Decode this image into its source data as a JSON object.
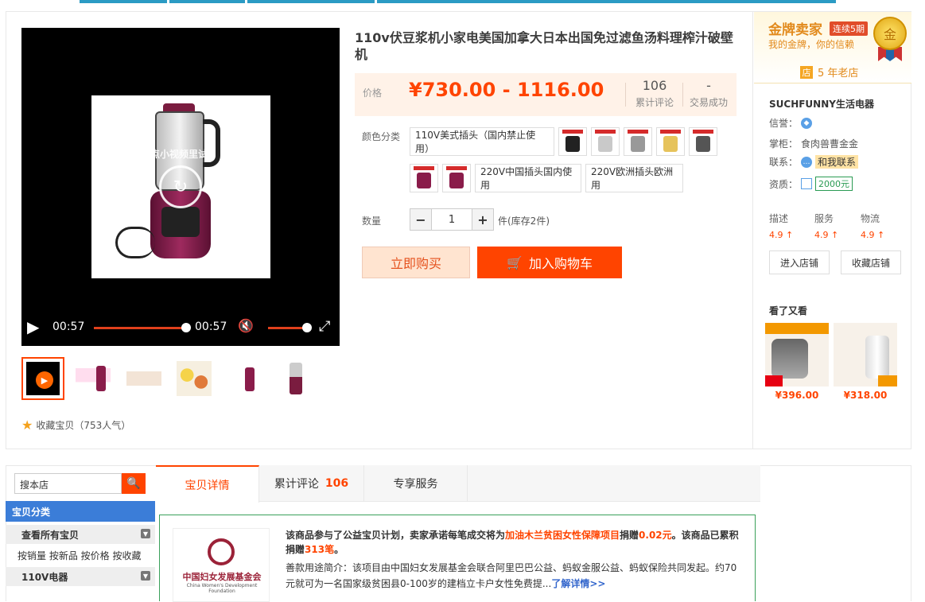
{
  "product": {
    "title": "110v伏豆浆机小家电美国加拿大日本出国免过滤鱼汤料理榨汁破壁机",
    "price_label": "价格",
    "price": "¥730.00 - 1116.00",
    "reviews_count": "106",
    "reviews_label": "累计评论",
    "sales_count": "-",
    "sales_label": "交易成功",
    "color_label": "颜色分类",
    "sku_options": [
      "110V美式插头（国内禁止使用）",
      "220V中国插头国内使用",
      "220V欧洲插头欧洲用"
    ],
    "qty_label": "数量",
    "qty_minus": "−",
    "qty_value": "1",
    "qty_plus": "+",
    "stock": "件(库存2件)",
    "buy_now": "立即购买",
    "add_cart": "加入购物车",
    "cart_icon": "🛒",
    "favorite": "收藏宝贝（753人气）",
    "star_icon": "★"
  },
  "video": {
    "overlay": "有点小视频里试",
    "current_time": "00:57",
    "total_time": "00:57",
    "progress": 1.0,
    "volume": 1.0,
    "play_icon": "▶",
    "mute_icon": "🔇",
    "fullscreen_icon": "⤢",
    "replay_icon": "↻"
  },
  "shop": {
    "gold_title": "金牌卖家",
    "gold_badge": "连续5期",
    "gold_sub": "我的金牌，你的信赖",
    "medal": "金",
    "years_icon": "店",
    "years": "5 年老店",
    "name": "SUCHFUNNY生活电器",
    "credit_label": "信誉：",
    "keeper_label": "掌柜：",
    "keeper": "食肉兽曹金金",
    "contact_label": "联系：",
    "contact": "和我联系",
    "qual_label": "资质：",
    "deposit": "2000元",
    "scores": [
      {
        "label": "描述",
        "value": "4.9 ↑"
      },
      {
        "label": "服务",
        "value": "4.9 ↑"
      },
      {
        "label": "物流",
        "value": "4.9 ↑"
      }
    ],
    "enter_shop": "进入店铺",
    "collect_shop": "收藏店铺",
    "seen_title": "看了又看",
    "seen_prices": [
      "¥396.00",
      "¥318.00"
    ]
  },
  "sidebar": {
    "search_placeholder": "搜本店",
    "search_icon": "🔍",
    "category_head": "宝贝分类",
    "all_items": "查看所有宝贝",
    "sort_links": "按销量 按新品 按价格 按收藏",
    "cat_110v": "110V电器",
    "collapse_icon": "▼"
  },
  "tabs": {
    "detail": "宝贝详情",
    "reviews": "累计评论",
    "reviews_num": "106",
    "service": "专享服务"
  },
  "charity": {
    "org_cn": "中国妇女发展基金会",
    "org_en": "China Women's Development Foundation",
    "line1_a": "该商品参与了公益宝贝计划，卖家承诺每笔成交将为",
    "line1_b": "加油木兰贫困女性保障项目",
    "line1_c": "捐赠",
    "line1_d": "0.02元",
    "line1_e": "。该商品已累积捐赠",
    "line1_f": "313笔",
    "line1_g": "。",
    "line2": "善款用途简介：该项目由中国妇女发展基金会联合阿里巴巴公益、蚂蚁金服公益、蚂蚁保险共同发起。约70元就可为一名国家级贫困县0-100岁的建档立卡户女性免费提...",
    "more": "了解详情>>"
  },
  "colors": {
    "accent": "#ff4400",
    "price": "#ff4400",
    "gold": "#e28a1c",
    "blue": "#3b7dd8"
  }
}
